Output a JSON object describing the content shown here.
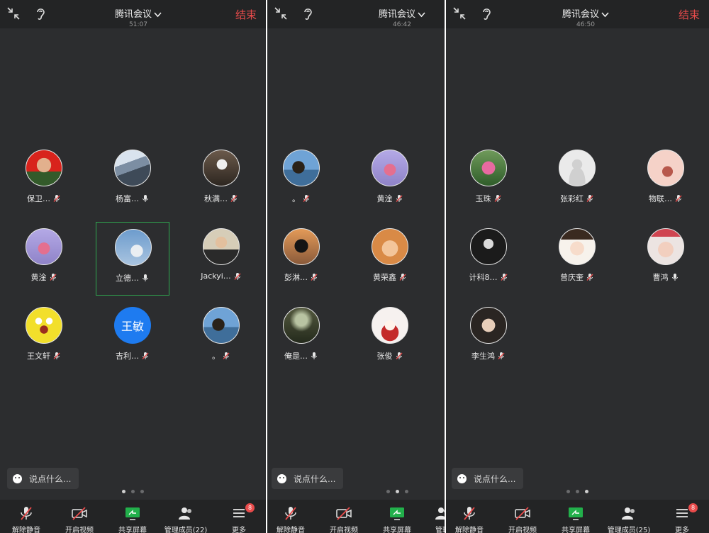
{
  "colors": {
    "accent_end": "#e94b4b",
    "active_border": "#2fa84f",
    "bg": "#2c2d2f",
    "bar": "#232425"
  },
  "panels": [
    {
      "title": "腾讯会议",
      "timer": "51:07",
      "end_label": "结束",
      "participants": [
        {
          "name": "保卫…",
          "avatar_icon": "soldier-photo",
          "muted": true
        },
        {
          "name": "杨富…",
          "avatar_icon": "street-photo",
          "muted": false
        },
        {
          "name": "秋满…",
          "avatar_icon": "figure-photo",
          "muted": true
        },
        {
          "name": "黄淦",
          "avatar_icon": "anime-girl-photo",
          "muted": true
        },
        {
          "name": "立德…",
          "avatar_icon": "sky-statue-photo",
          "muted": false,
          "active": true
        },
        {
          "name": "Jackyi…",
          "avatar_icon": "man-portrait-photo",
          "muted": true
        },
        {
          "name": "王文轩",
          "avatar_icon": "sponge-cartoon",
          "muted": true
        },
        {
          "name": "吉利…",
          "avatar_text": "王敏",
          "muted": true
        },
        {
          "name": "。",
          "avatar_icon": "man-lake-photo",
          "muted": true
        }
      ],
      "chat_placeholder": "说点什么...",
      "page_dots": {
        "count": 3,
        "active": 0
      },
      "toolbar": [
        {
          "label": "解除静音",
          "icon": "mic-muted-icon"
        },
        {
          "label": "开启视频",
          "icon": "video-off-icon"
        },
        {
          "label": "共享屏幕",
          "icon": "share-screen-icon"
        },
        {
          "label": "管理成员(22)",
          "icon": "members-icon"
        },
        {
          "label": "更多",
          "icon": "menu-icon",
          "badge": "8"
        }
      ]
    },
    {
      "title": "腾讯会议",
      "timer": "46:42",
      "end_label": "",
      "participants": [
        {
          "name": "。",
          "avatar_icon": "man-lake-photo",
          "muted": true
        },
        {
          "name": "黄淦",
          "avatar_icon": "anime-girl-photo",
          "muted": true
        },
        {
          "name": "彭淋…",
          "avatar_icon": "silhouette-photo",
          "muted": true
        },
        {
          "name": "黄荣鑫",
          "avatar_icon": "cat-photo",
          "muted": true
        },
        {
          "name": "俺是…",
          "avatar_icon": "forest-photo",
          "muted": false
        },
        {
          "name": "张俊",
          "avatar_icon": "cartoon-girl-red",
          "muted": true
        }
      ],
      "chat_placeholder": "说点什么...",
      "page_dots": {
        "count": 3,
        "active": 1
      },
      "toolbar": [
        {
          "label": "解除静音",
          "icon": "mic-muted-icon"
        },
        {
          "label": "开启视频",
          "icon": "video-off-icon"
        },
        {
          "label": "共享屏幕",
          "icon": "share-screen-icon"
        },
        {
          "label": "管理",
          "icon": "members-icon"
        }
      ]
    },
    {
      "title": "腾讯会议",
      "timer": "46:50",
      "end_label": "结束",
      "participants": [
        {
          "name": "玉珠",
          "avatar_icon": "flower-photo",
          "muted": true
        },
        {
          "name": "张彩红",
          "avatar_icon": "default-avatar",
          "muted": true
        },
        {
          "name": "物联…",
          "avatar_icon": "pink-drawing",
          "muted": true
        },
        {
          "name": "计科8…",
          "avatar_icon": "bw-girl-photo",
          "muted": true
        },
        {
          "name": "曾庆奎",
          "avatar_icon": "cartoon-boy",
          "muted": true
        },
        {
          "name": "曹鸿",
          "avatar_icon": "baby-photo",
          "muted": false
        },
        {
          "name": "李生鸿",
          "avatar_icon": "young-man-photo",
          "muted": true
        }
      ],
      "chat_placeholder": "说点什么...",
      "page_dots": {
        "count": 3,
        "active": 2
      },
      "toolbar": [
        {
          "label": "解除静音",
          "icon": "mic-muted-icon"
        },
        {
          "label": "开启视频",
          "icon": "video-off-icon"
        },
        {
          "label": "共享屏幕",
          "icon": "share-screen-icon"
        },
        {
          "label": "管理成员(25)",
          "icon": "members-icon"
        },
        {
          "label": "更多",
          "icon": "menu-icon",
          "badge": "8"
        }
      ]
    }
  ]
}
